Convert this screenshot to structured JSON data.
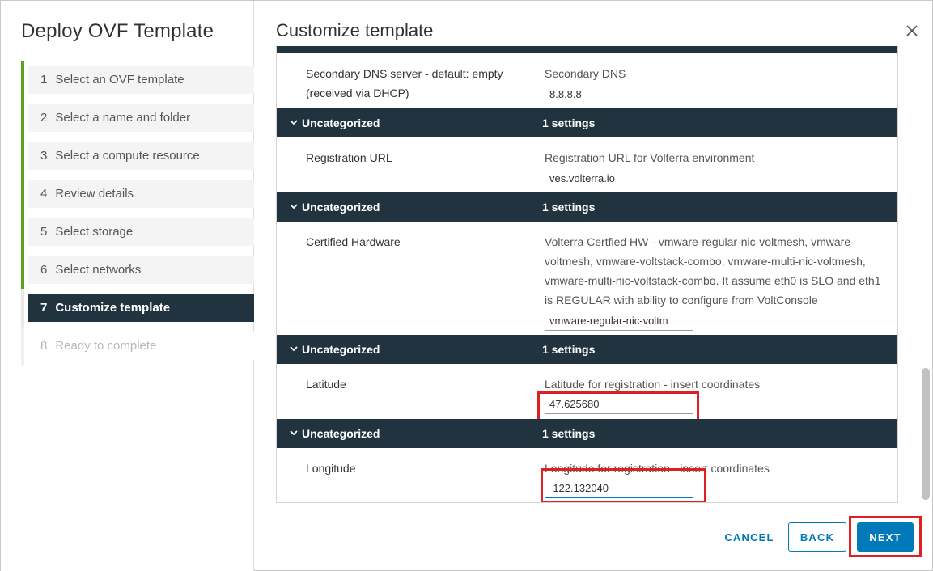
{
  "wizard": {
    "title": "Deploy OVF Template",
    "steps": [
      {
        "num": "1",
        "label": "Select an OVF template",
        "state": "done"
      },
      {
        "num": "2",
        "label": "Select a name and folder",
        "state": "done"
      },
      {
        "num": "3",
        "label": "Select a compute resource",
        "state": "done"
      },
      {
        "num": "4",
        "label": "Review details",
        "state": "done"
      },
      {
        "num": "5",
        "label": "Select storage",
        "state": "done"
      },
      {
        "num": "6",
        "label": "Select networks",
        "state": "done"
      },
      {
        "num": "7",
        "label": "Customize template",
        "state": "active"
      },
      {
        "num": "8",
        "label": "Ready to complete",
        "state": "disabled"
      }
    ]
  },
  "page": {
    "title": "Customize template"
  },
  "rows": {
    "dns": {
      "label_line1": "Secondary DNS server - default: empty",
      "label_line2": "(received via DHCP)",
      "desc": "Secondary DNS",
      "value": "8.8.8.8"
    },
    "reg": {
      "group": "Uncategorized",
      "count": "1 settings",
      "label": "Registration URL",
      "desc": "Registration URL for Volterra environment",
      "value": "ves.volterra.io"
    },
    "hw": {
      "group": "Uncategorized",
      "count": "1 settings",
      "label": "Certified Hardware",
      "desc_line1": "Volterra Certfied HW - vmware-regular-nic-voltmesh, vmware-",
      "desc_line2": "voltmesh, vmware-voltstack-combo, vmware-multi-nic-voltmesh,",
      "desc_line3": "vmware-multi-nic-voltstack-combo. It assume eth0 is SLO and eth1",
      "desc_line4": "is REGULAR with ability to configure from VoltConsole",
      "value": "vmware-regular-nic-voltm"
    },
    "lat": {
      "group": "Uncategorized",
      "count": "1 settings",
      "label": "Latitude",
      "desc": "Latitude for registration - insert coordinates",
      "value": "47.625680"
    },
    "lon": {
      "group": "Uncategorized",
      "count": "1 settings",
      "label": "Longitude",
      "desc": "Longitude for registration - insert coordinates",
      "value": "-122.132040"
    }
  },
  "footer": {
    "cancel_label": "CANCEL",
    "back_label": "BACK",
    "next_label": "NEXT"
  },
  "colors": {
    "accent": "#0079b8",
    "header_bg": "#21333f",
    "step_done": "#5aa220",
    "highlight": "#e02020"
  },
  "icons": {
    "close": "close-icon",
    "chevron": "chevron-down-icon"
  }
}
